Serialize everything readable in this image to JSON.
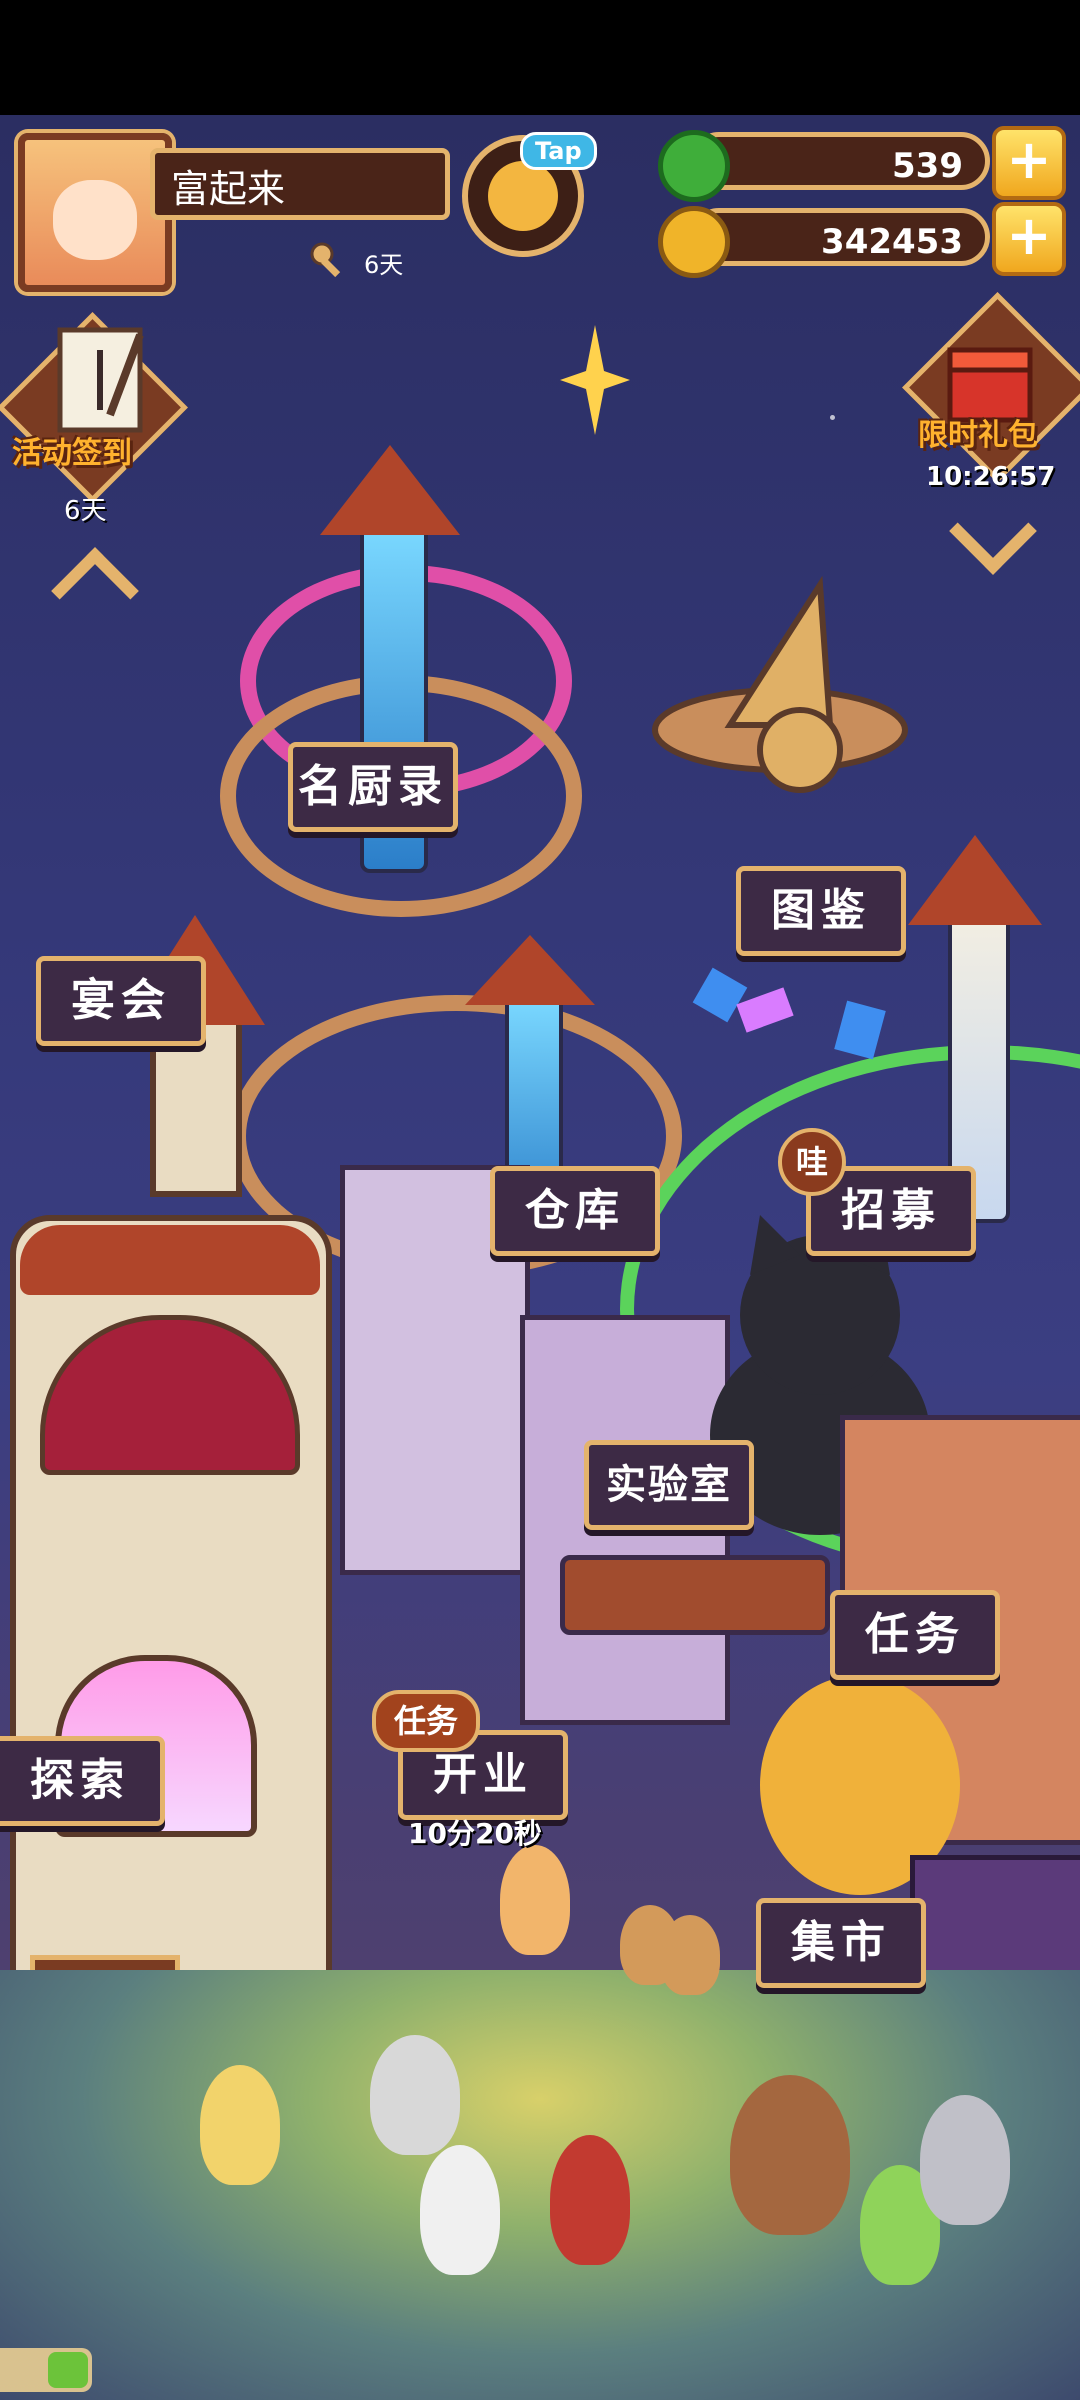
{
  "player": {
    "name": "富起来",
    "key_days": "6天"
  },
  "tap_badge": "Tap",
  "currencies": [
    {
      "name": "jade",
      "value": "539",
      "icon": "jade-coin-icon",
      "color": "#3fae3a"
    },
    {
      "name": "gold",
      "value": "342453",
      "icon": "gold-coin-icon",
      "color": "#f0b429"
    }
  ],
  "left_event": {
    "label": "活动签到",
    "days": "6天"
  },
  "right_event": {
    "label": "限时礼包",
    "timer": "10:26:57"
  },
  "signs": {
    "chef": "名厨录",
    "collection": "图鉴",
    "banquet": "宴会",
    "warehouse": "仓库",
    "recruit": "招募",
    "recruit_badge": "哇",
    "lab": "实验室",
    "task": "任务",
    "explore": "探索",
    "open": "开业",
    "open_badge": "任务",
    "open_timer": "10分20秒",
    "market": "集市"
  },
  "colors": {
    "accent_gold": "#e4b36c",
    "sign_bg": "#3d2a45",
    "event_label": "#ffb22e"
  }
}
